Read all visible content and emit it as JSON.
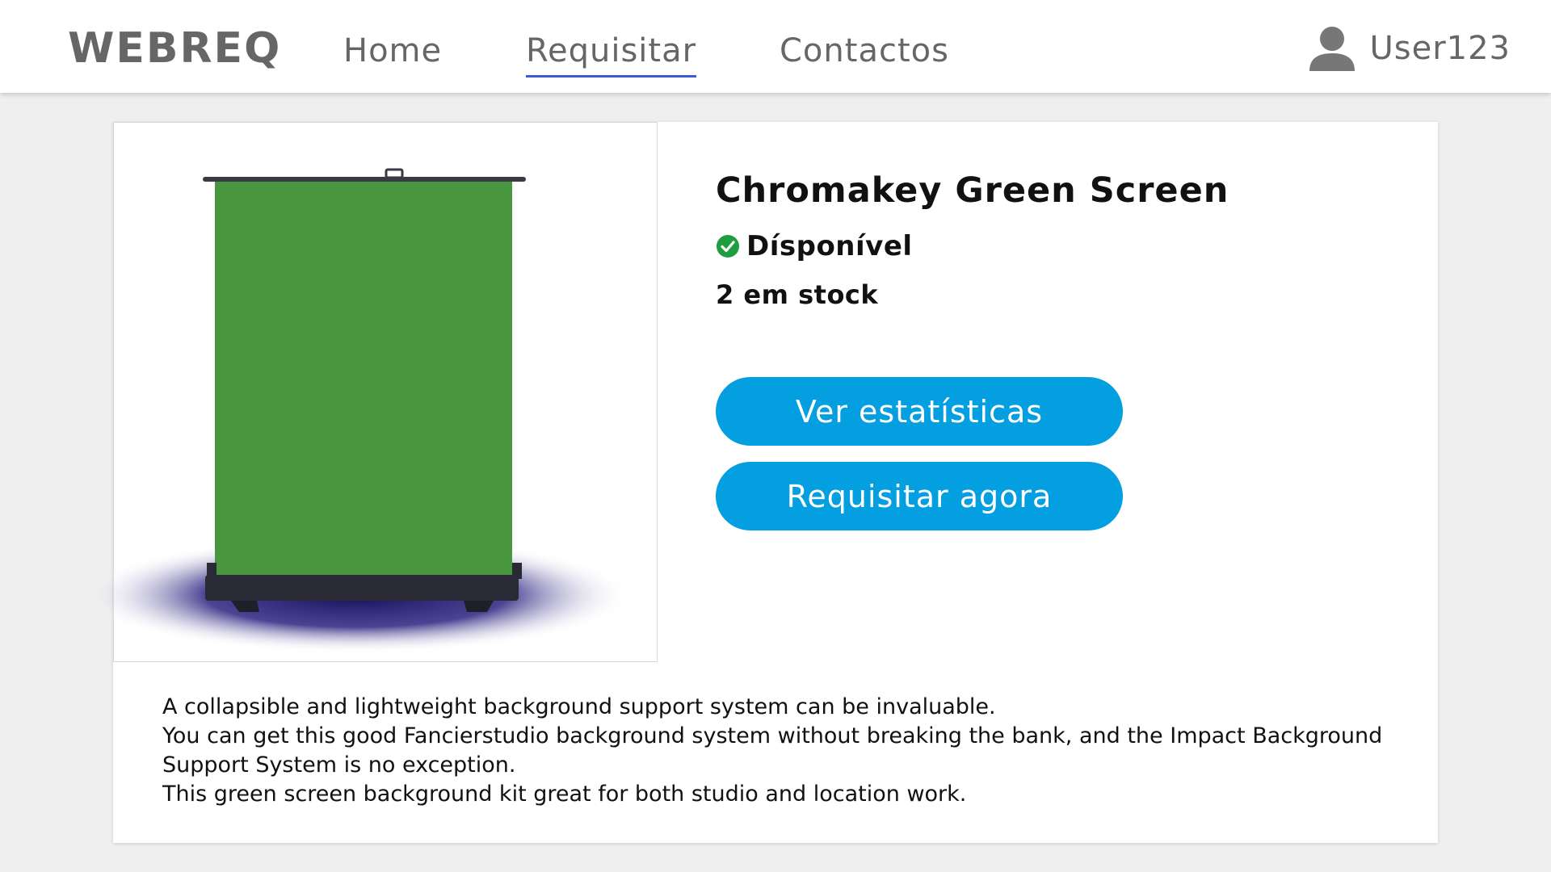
{
  "header": {
    "brand": "WEBREQ",
    "nav": [
      {
        "label": "Home",
        "active": false
      },
      {
        "label": "Requisitar",
        "active": true
      },
      {
        "label": "Contactos",
        "active": false
      }
    ],
    "user": {
      "name": "User123",
      "icon": "user-icon"
    }
  },
  "product": {
    "title": "Chromakey Green Screen",
    "availability": {
      "label": "Dísponível",
      "icon": "check-circle-icon",
      "color": "#1e9e3e"
    },
    "stock": "2 em stock",
    "buttons": {
      "stats": "Ver estatísticas",
      "request": "Requisitar agora"
    },
    "image": {
      "icon": "green-screen-image",
      "screen_color": "#48973f"
    },
    "description": [
      "A collapsible and lightweight background support system can be invaluable.",
      "You can get this good Fancierstudio background system without breaking the bank, and the Impact Background Support System is no exception.",
      "This green screen background kit great for both studio and location work."
    ]
  },
  "colors": {
    "accent": "#039fe0",
    "nav_underline": "#3b5bdb",
    "background": "#efefef"
  }
}
